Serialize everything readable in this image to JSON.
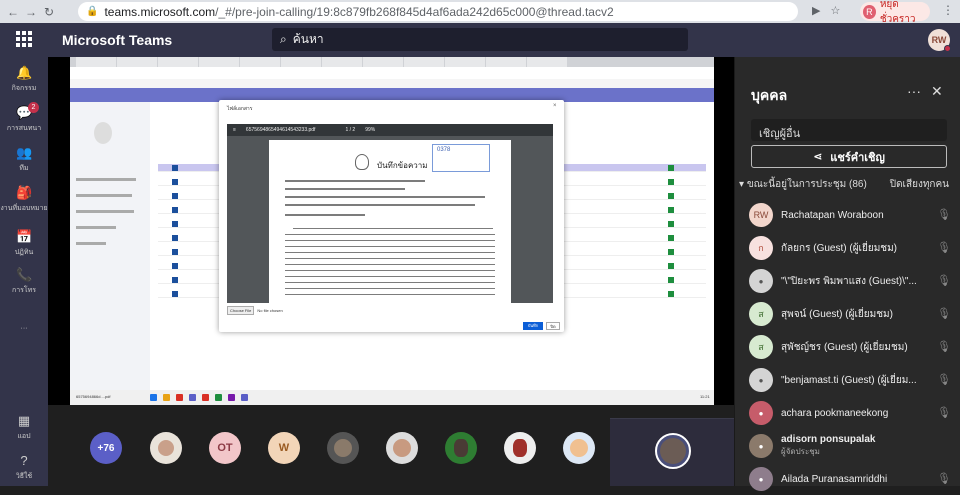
{
  "browser": {
    "url_host": "teams.microsoft.com",
    "url_path": "/_#/pre-join-calling/19:8c879fb268f845d4af6ada242d65c000@thread.tacv2",
    "profile_initial": "R",
    "profile_label": "หยุดชั่วคราว"
  },
  "teams": {
    "title": "Microsoft Teams",
    "search_placeholder": "ค้นหา",
    "me_initials": "RW"
  },
  "rail": [
    {
      "label": "กิจกรรม",
      "icon": "bell-icon",
      "glyph": "🔔"
    },
    {
      "label": "การสนทนา",
      "icon": "chat-icon",
      "glyph": "💬",
      "badge": "2"
    },
    {
      "label": "ทีม",
      "icon": "teams-icon",
      "glyph": "👥"
    },
    {
      "label": "งานที่มอบหมาย",
      "icon": "assignments-icon",
      "glyph": "🎒"
    },
    {
      "label": "ปฏิทิน",
      "icon": "calendar-icon",
      "glyph": "📅"
    },
    {
      "label": "การโทร",
      "icon": "phone-icon",
      "glyph": "📞"
    },
    {
      "label": "···",
      "icon": "more-icon",
      "glyph": ""
    },
    {
      "label": "แอป",
      "icon": "apps-icon",
      "glyph": "▦"
    },
    {
      "label": "วิธีใช้",
      "icon": "help-icon",
      "glyph": "?"
    }
  ],
  "shared_screen": {
    "dialog_title": "ไฟล์เอกสาร",
    "pdf_filename": "6575694865494614543233.pdf",
    "pdf_page": "1 / 2",
    "pdf_zoom": "99%",
    "doc_title": "บันทึกข้อความ",
    "stamp_text": "0378",
    "choose_file": "Choose File",
    "no_file": "No file chosen",
    "save_label": "บันทึก",
    "close_label": "ปิด",
    "taskbar_file": "6575694866d....pdf",
    "clock": "11:21"
  },
  "strip": {
    "more_count": "+76",
    "tiles": [
      "",
      "OT",
      "W",
      "",
      "",
      "",
      "",
      ""
    ]
  },
  "panel": {
    "title": "บุคคล",
    "invite_placeholder": "เชิญผู้อื่น",
    "share_invite": "แชร์คำเชิญ",
    "in_meeting": "ขณะนี้อยู่ในการประชุม (86)",
    "mute_all": "ปิดเสียงทุกคน",
    "people": [
      {
        "name": "Rachatapan Woraboon",
        "initials": "RW",
        "color": "#f2d6cc",
        "fg": "#8a4a3a"
      },
      {
        "name": "กัลยกร (Guest) (ผู้เยี่ยมชม)",
        "initials": "ก",
        "color": "#f7e1df",
        "fg": "#b04a3a"
      },
      {
        "name": "\"\\\"ปิยะพร พิมพาแสง (Guest)\\\"...",
        "initials": "",
        "color": "#d4d4d4",
        "fg": "#555"
      },
      {
        "name": "สุพจน์ (Guest) (ผู้เยี่ยมชม)",
        "initials": "ส",
        "color": "#d7ead0",
        "fg": "#3b6b2c"
      },
      {
        "name": "สุพัชญ์ชร (Guest) (ผู้เยี่ยมชม)",
        "initials": "ส",
        "color": "#d7ead0",
        "fg": "#3b6b2c"
      },
      {
        "name": "\"benjamast.ti (Guest) (ผู้เยี่ยม...",
        "initials": "",
        "color": "#d4d4d4",
        "fg": "#555"
      },
      {
        "name": "achara pookmaneekong",
        "initials": "",
        "color": "#c65c6a",
        "fg": "#fff"
      },
      {
        "name": "adisorn ponsupalak",
        "initials": "",
        "color": "#8b7a6b",
        "fg": "#fff",
        "sub": "ผู้จัดประชุม",
        "bold": true
      },
      {
        "name": "Ailada Puranasamriddhi",
        "initials": "",
        "color": "#8e7d8c",
        "fg": "#fff"
      }
    ]
  }
}
